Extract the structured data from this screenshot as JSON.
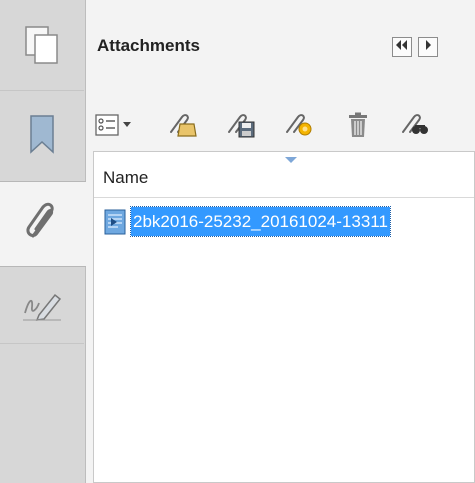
{
  "panel": {
    "title": "Attachments"
  },
  "rail": {
    "tabs": [
      {
        "name": "pages",
        "icon": "pages-icon"
      },
      {
        "name": "bookmarks",
        "icon": "bookmark-icon"
      },
      {
        "name": "attachments",
        "icon": "paperclip-icon",
        "active": true
      },
      {
        "name": "signatures",
        "icon": "signature-icon"
      }
    ]
  },
  "toolbar": {
    "tools": [
      "options-menu-icon",
      "open-attachment-icon",
      "save-attachment-icon",
      "add-attachment-icon",
      "delete-icon",
      "search-attachments-icon"
    ]
  },
  "list": {
    "column_name": "Name",
    "rows": [
      {
        "label": "2bk2016-25232_20161024-13311",
        "selected": true
      }
    ]
  },
  "colors": {
    "selection": "#3399ff",
    "rail": "#d7d7d7",
    "panel": "#f3f3f3"
  }
}
